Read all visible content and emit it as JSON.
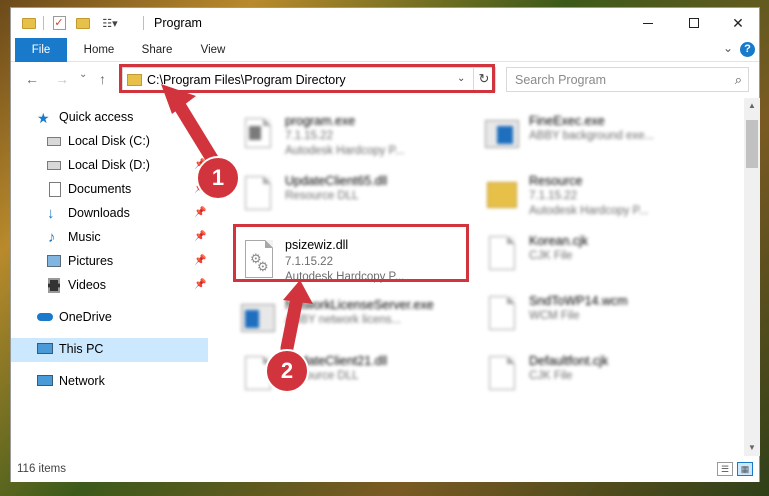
{
  "window": {
    "title": "Program",
    "quick_access_toolbar": [
      "folder-icon",
      "properties-check-icon",
      "new-folder-icon",
      "customize-dropdown-icon"
    ],
    "controls": {
      "minimize": "minimize",
      "maximize": "maximize",
      "close": "✕"
    }
  },
  "ribbon": {
    "tabs": [
      {
        "label": "File",
        "active": true
      },
      {
        "label": "Home"
      },
      {
        "label": "Share"
      },
      {
        "label": "View"
      }
    ],
    "expand_glyph": "⌄",
    "help_glyph": "?"
  },
  "address": {
    "back_glyph": "←",
    "forward_glyph": "→",
    "recent_glyph": "⌄",
    "up_glyph": "↑",
    "path": "C:\\Program Files\\Program Directory",
    "dropdown_glyph": "⌄",
    "refresh_glyph": "↻"
  },
  "search": {
    "placeholder": "Search Program",
    "icon": "search-icon",
    "glyph": "⌕"
  },
  "sidebar": {
    "items": [
      {
        "label": "Quick access",
        "icon": "star-icon",
        "pinned": false
      },
      {
        "label": "Local Disk (C:)",
        "icon": "drive-icon",
        "pinned": true
      },
      {
        "label": "Local Disk (D:)",
        "icon": "drive-icon",
        "pinned": true
      },
      {
        "label": "Documents",
        "icon": "documents-icon",
        "pinned": true
      },
      {
        "label": "Downloads",
        "icon": "download-icon",
        "pinned": true
      },
      {
        "label": "Music",
        "icon": "music-icon",
        "pinned": true
      },
      {
        "label": "Pictures",
        "icon": "pictures-icon",
        "pinned": true
      },
      {
        "label": "Videos",
        "icon": "videos-icon",
        "pinned": true
      },
      {
        "label": "OneDrive",
        "icon": "cloud-icon",
        "pinned": false
      },
      {
        "label": "This PC",
        "icon": "computer-icon",
        "selected": true
      },
      {
        "label": "Network",
        "icon": "network-icon",
        "pinned": false
      }
    ],
    "pin_glyph": "📌"
  },
  "files": [
    {
      "name": "program.exe",
      "line2": "7.1.15.22",
      "line3": "Autodesk Hardcopy P...",
      "icon": "exe-window-icon"
    },
    {
      "name": "FineExec.exe",
      "line2": "ABBY background exe...",
      "line3": "",
      "icon": "exe-window-icon"
    },
    {
      "name": "UpdateClient65.dll",
      "line2": "Resource DLL",
      "line3": "",
      "icon": "dll-gear-icon"
    },
    {
      "name": "Resource",
      "line2": "7.1.15.22",
      "line3": "Autodesk Hardcopy P...",
      "icon": "folder-icon"
    },
    {
      "name": "psizewiz.dll",
      "line2": "7.1.15.22",
      "line3": "Autodesk Hardcopy P...",
      "icon": "dll-gear-icon",
      "highlighted": true
    },
    {
      "name": "Korean.cjk",
      "line2": "CJK File",
      "line3": "",
      "icon": "blank-file-icon"
    },
    {
      "name": "NetworkLicenseServer.exe",
      "line2": "ABBY network licens...",
      "line3": "",
      "icon": "exe-window-icon"
    },
    {
      "name": "SndToWP14.wcm",
      "line2": "WCM File",
      "line3": "",
      "icon": "blank-file-icon"
    },
    {
      "name": "UpdateClient21.dll",
      "line2": "Resource DLL",
      "line3": "",
      "icon": "dll-gear-icon"
    },
    {
      "name": "Defaultfont.cjk",
      "line2": "CJK File",
      "line3": "",
      "icon": "blank-file-icon"
    }
  ],
  "status": {
    "item_count": "116 items",
    "view_details_glyph": "☰",
    "view_icons_glyph": "▦"
  },
  "annotations": [
    {
      "number": "1",
      "target": "address-bar"
    },
    {
      "number": "2",
      "target": "psizewiz.dll"
    }
  ],
  "colors": {
    "accent": "#1979ca",
    "annotation": "#d1343c",
    "selection": "#cce8ff"
  }
}
